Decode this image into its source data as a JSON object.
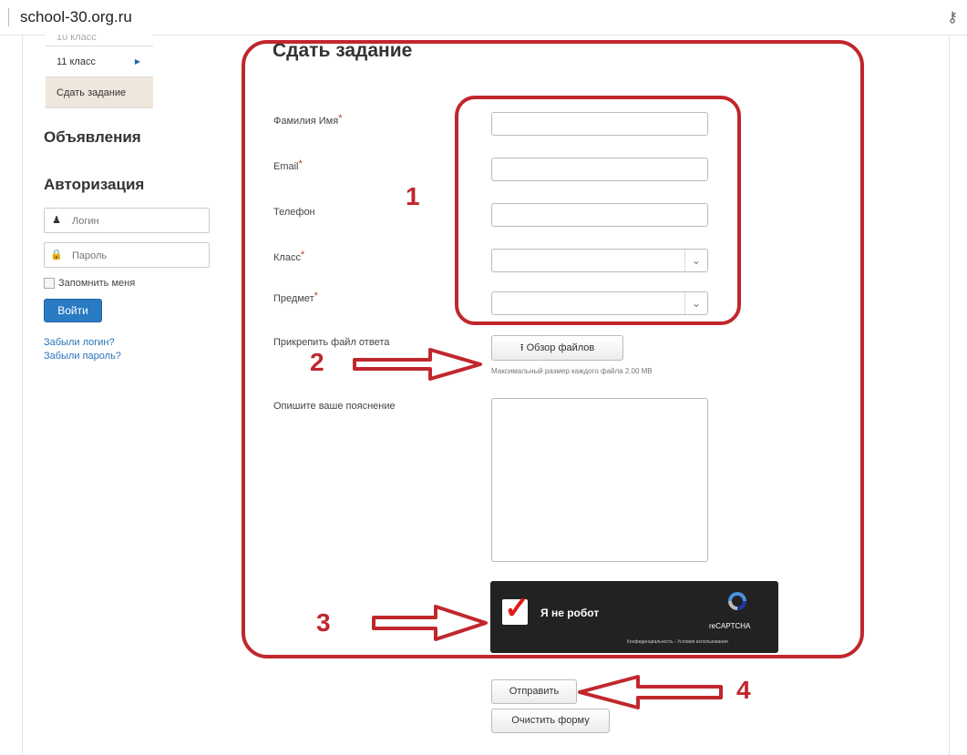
{
  "browser": {
    "url": "school-30.org.ru",
    "key_icon": "key-icon"
  },
  "sidebar": {
    "menu_items": [
      {
        "label": "10 класс"
      },
      {
        "label": "11 класс"
      },
      {
        "label": "Сдать задание"
      }
    ],
    "announcements_heading": "Объявления",
    "auth_heading": "Авторизация",
    "login_placeholder": "Логин",
    "password_placeholder": "Пароль",
    "remember_label": "Запомнить меня",
    "login_button": "Войти",
    "forgot_login": "Забыли логин?",
    "forgot_password": "Забыли пароль?"
  },
  "form": {
    "title": "Сдать задание",
    "fields": {
      "name_label": "Фамилия Имя",
      "email_label": "Email",
      "phone_label": "Телефон",
      "class_label": "Класс",
      "subject_label": "Предмет",
      "required_mark": "*"
    },
    "attach_label": "Прикрепить файл ответа",
    "browse_button": "Обзор файлов",
    "max_size_hint": "Максимальный размер каждого файла 2.00 MB",
    "comment_label": "Опишите ваше пояснение",
    "captcha": {
      "label": "Я не робот",
      "brand": "reCAPTCHA",
      "terms": "Конфиденциальность - Условия использования",
      "checked": true
    },
    "submit_button": "Отправить",
    "clear_button": "Очистить форму"
  },
  "annotations": {
    "n1": "1",
    "n2": "2",
    "n3": "3",
    "n4": "4"
  },
  "colors": {
    "annotation": "#c0272d",
    "primary_button": "#2a7bc4",
    "active_menu": "#efe6dc"
  }
}
